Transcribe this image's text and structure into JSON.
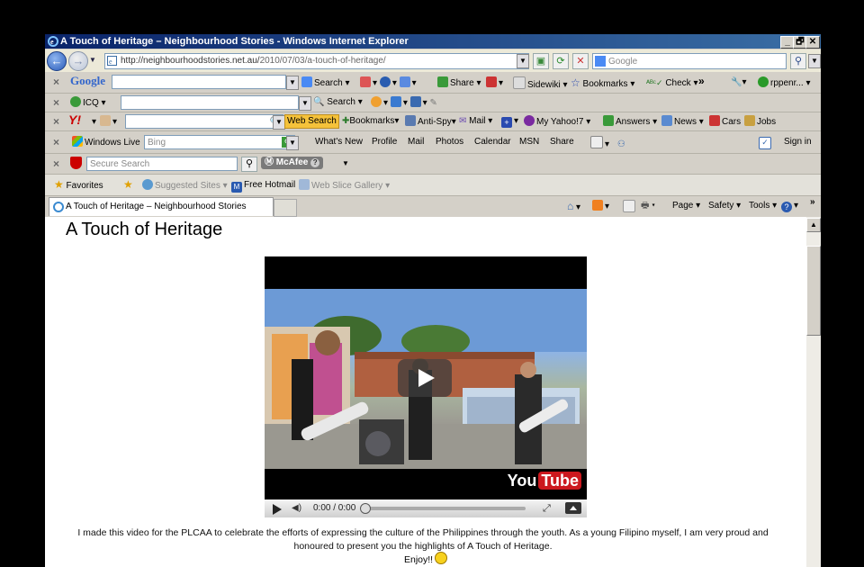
{
  "window": {
    "title": "A Touch of Heritage – Neighbourhood Stories - Windows Internet Explorer",
    "controls": [
      "_",
      "🗗",
      "✕"
    ]
  },
  "address_bar": {
    "url_prefix": "http://neighbourhoodstories.net.au/",
    "url_rest": "2010/07/03/a-touch-of-heritage/",
    "search_placeholder": "Google"
  },
  "google_bar": {
    "logo": "Google",
    "search_label": "Search",
    "share_label": "Share",
    "sidewiki_label": "Sidewiki",
    "bookmarks_label": "Bookmarks",
    "check_label": "Check",
    "more_label": "»",
    "user_label": "rppenr..."
  },
  "icq_bar": {
    "logo": "ICQ",
    "search_label": "Search"
  },
  "yahoo_bar": {
    "logo": "Y!",
    "web_search_label": "Web Search",
    "bookmarks_label": "Bookmarks",
    "antispy_label": "Anti-Spy",
    "mail_label": "Mail",
    "my_yahoo_label": "My Yahoo!7",
    "answers_label": "Answers",
    "news_label": "News",
    "cars_label": "Cars",
    "jobs_label": "Jobs"
  },
  "live_bar": {
    "logo": "Windows Live",
    "search_placeholder": "Bing",
    "items": [
      "What's New",
      "Profile",
      "Mail",
      "Photos",
      "Calendar",
      "MSN",
      "Share"
    ],
    "signin_label": "Sign in"
  },
  "mcafee_bar": {
    "search_placeholder": "Secure Search",
    "brand": "McAfee"
  },
  "favorites_bar": {
    "favorites_label": "Favorites",
    "suggested_label": "Suggested Sites",
    "hotmail_label": "Free Hotmail",
    "webslice_label": "Web Slice Gallery"
  },
  "tabs": {
    "active_tab": "A Touch of Heritage – Neighbourhood Stories",
    "command_items": [
      "Page",
      "Safety",
      "Tools"
    ]
  },
  "page": {
    "title": "A Touch of Heritage",
    "video": {
      "time": "0:00 / 0:00",
      "brand_you": "You",
      "brand_tube": "Tube"
    },
    "description": "I made this video for the PLCAA to celebrate the efforts of expressing the culture of the Philippines through the youth. As a young Filipino myself, I am very proud and honoured to present you the highlights of A Touch of Heritage.",
    "enjoy": "Enjoy!!"
  },
  "colors": {
    "titlebar_start": "#0a246a",
    "titlebar_end": "#3a6ea5",
    "chrome": "#d4d0c8",
    "youtube_red": "#cc181e",
    "web_search_bg": "#f5c23a"
  }
}
